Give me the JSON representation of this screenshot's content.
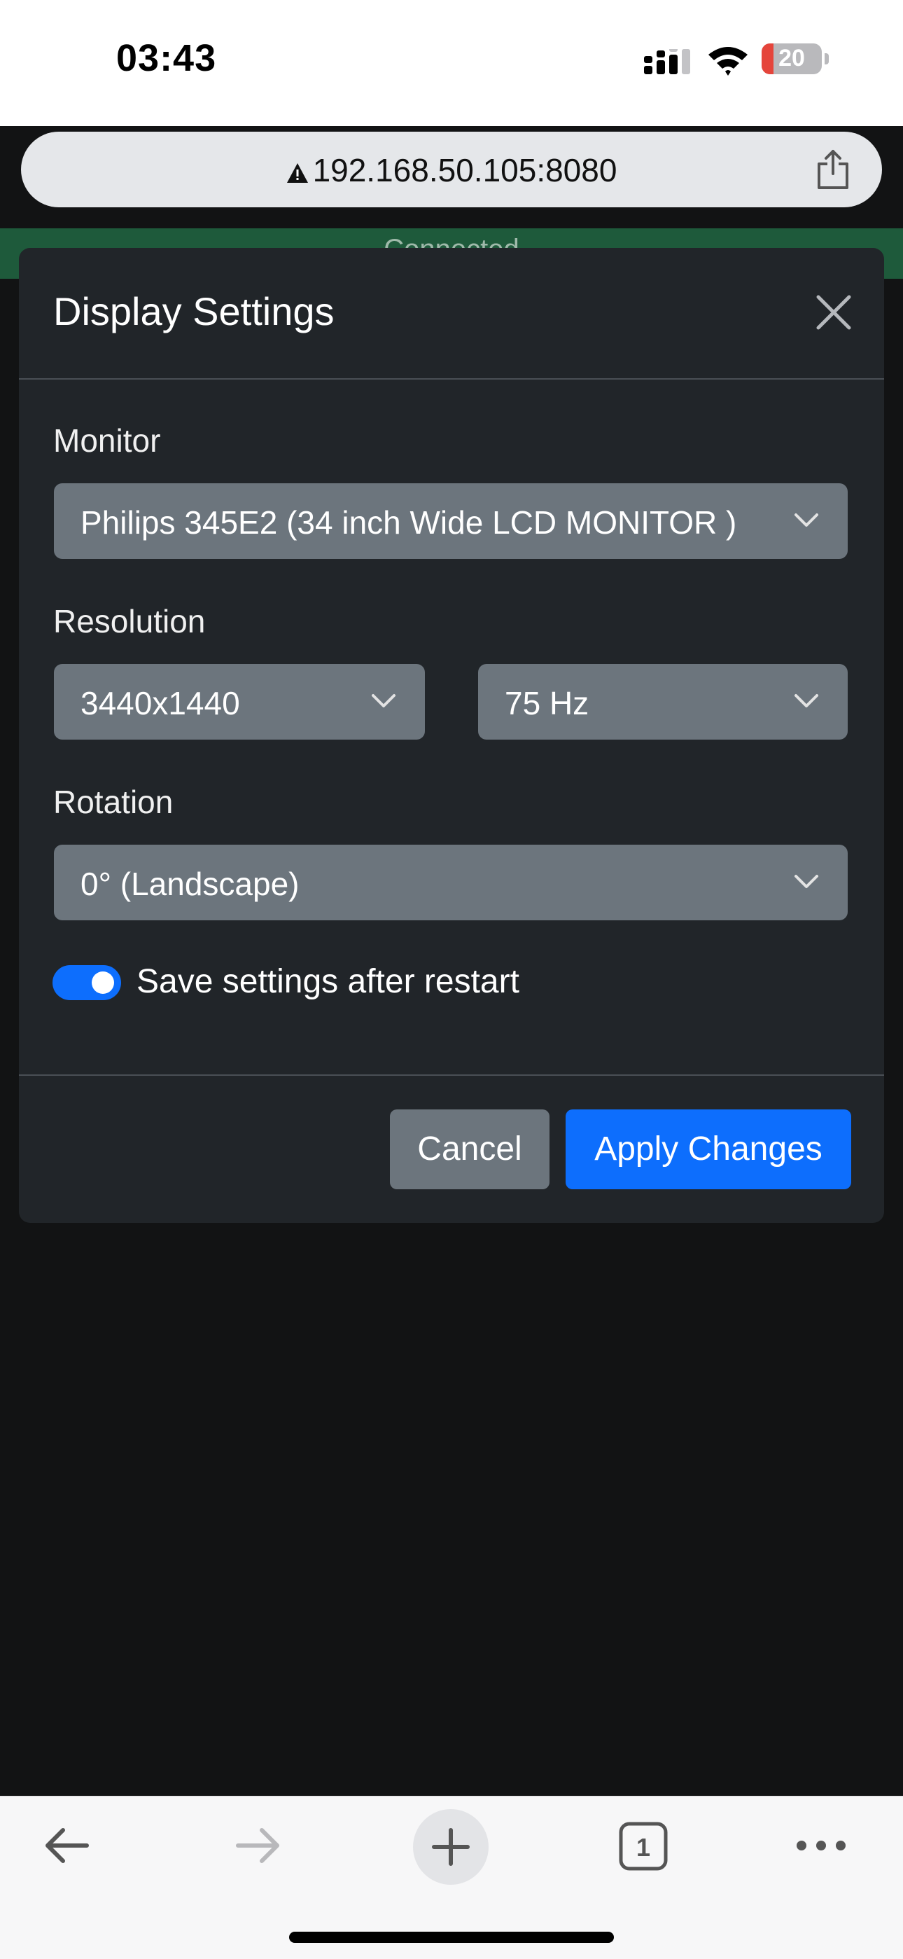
{
  "status_bar": {
    "time": "03:43",
    "battery": "20",
    "battery_level": 0.2
  },
  "browser": {
    "url": "192.168.50.105:8080",
    "tab_count": "1"
  },
  "background": {
    "connected_text": "Connected"
  },
  "modal": {
    "title": "Display Settings",
    "monitor_label": "Monitor",
    "monitor_value": "Philips 345E2 (34 inch Wide LCD MONITOR )",
    "resolution_label": "Resolution",
    "resolution_value": "3440x1440",
    "refresh_value": "75 Hz",
    "rotation_label": "Rotation",
    "rotation_value": "0° (Landscape)",
    "save_toggle_label": "Save settings after restart",
    "save_toggle_on": true,
    "cancel_label": "Cancel",
    "apply_label": "Apply Changes"
  },
  "colors": {
    "primary": "#0d6efd",
    "secondary": "#6c757d",
    "modal_bg": "#212529",
    "connected_bg": "#1e5a3b"
  },
  "icons": [
    "signal-icon",
    "wifi-icon",
    "battery-icon",
    "warning-icon",
    "share-icon",
    "close-icon",
    "chevron-down-icon",
    "back-arrow-icon",
    "forward-arrow-icon",
    "plus-icon",
    "tabs-icon",
    "more-icon"
  ]
}
